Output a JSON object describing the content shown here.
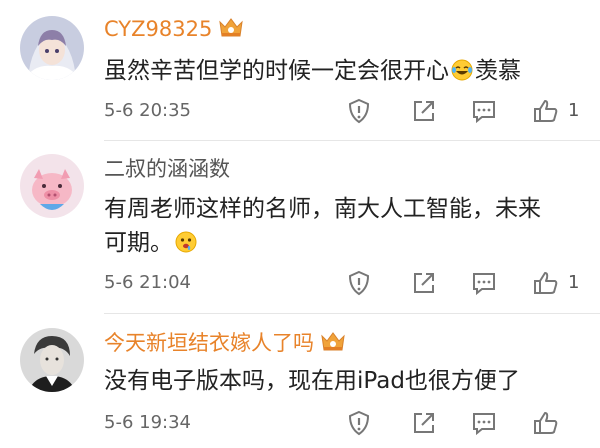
{
  "comments": [
    {
      "username": "CYZ98325",
      "vip": true,
      "text_before": "虽然辛苦但学的时候一定会很开心",
      "emoji": "laughing-tears-emoji",
      "text_after": "羡慕",
      "time": "5-6 20:35",
      "likes": "1"
    },
    {
      "username": "二叔的涵涵数",
      "vip": false,
      "text_before": "有周老师这样的名师，南大人工智能，未来",
      "text_line2": "可期。",
      "emoji": "drooling-face-emoji",
      "time": "5-6 21:04",
      "likes": "1"
    },
    {
      "username": "今天新垣结衣嫁人了吗",
      "vip": true,
      "text_before": "没有电子版本吗，现在用iPad也很方便了",
      "time": "5-6 19:34",
      "likes": ""
    }
  ],
  "icons": {
    "report": "exclamation-shield-icon",
    "share": "share-icon",
    "reply": "comment-icon",
    "like": "thumbs-up-icon",
    "vip": "crown-icon"
  },
  "colors": {
    "vip_name": "#e8832a",
    "normal_name": "#555555",
    "text": "#222222",
    "meta": "#666666",
    "icon": "#777777"
  }
}
